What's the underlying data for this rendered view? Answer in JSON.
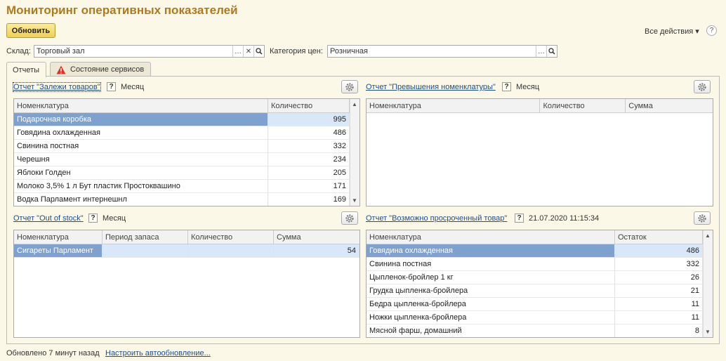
{
  "title": "Мониторинг оперативных показателей",
  "refresh_label": "Обновить",
  "all_actions": "Все действия",
  "help": "?",
  "warehouse": {
    "label": "Склад:",
    "value": "Торговый зал"
  },
  "price_category": {
    "label": "Категория цен:",
    "value": "Розничная"
  },
  "tabs": [
    {
      "label": "Отчеты"
    },
    {
      "label": "Состояние сервисов"
    }
  ],
  "reports": {
    "stale": {
      "link": "Отчет \"Залежи товаров\"",
      "period": "Месяц",
      "columns": [
        "Номенклатура",
        "Количество"
      ],
      "rows": [
        [
          "Подарочная коробка",
          "995"
        ],
        [
          "Говядина охлажденная",
          "486"
        ],
        [
          "Свинина постная",
          "332"
        ],
        [
          "Черешня",
          "234"
        ],
        [
          "Яблоки Голден",
          "205"
        ],
        [
          "Молоко 3,5% 1 л Бут пластик Простоквашино",
          "171"
        ],
        [
          "Водка Парламент интернешнл",
          "169"
        ]
      ]
    },
    "excess": {
      "link": "Отчет \"Превышения номенклатуры\"",
      "period": "Месяц",
      "columns": [
        "Номенклатура",
        "Количество",
        "Сумма"
      ],
      "rows": []
    },
    "oos": {
      "link": "Отчет \"Out of stock\"",
      "period": "Месяц",
      "columns": [
        "Номенклатура",
        "Период запаса",
        "Количество",
        "Сумма"
      ],
      "rows": [
        [
          "Сигареты Парламент",
          "",
          "",
          "54"
        ]
      ]
    },
    "expired": {
      "link": "Отчет \"Возможно просроченный товар\"",
      "period": "21.07.2020 11:15:34",
      "columns": [
        "Номенклатура",
        "Остаток"
      ],
      "rows": [
        [
          "Говядина охлажденная",
          "486"
        ],
        [
          "Свинина постная",
          "332"
        ],
        [
          "Цыпленок-бройлер 1 кг",
          "26"
        ],
        [
          "Грудка цыпленка-бройлера",
          "21"
        ],
        [
          "Бедра цыпленка-бройлера",
          "11"
        ],
        [
          "Ножки цыпленка-бройлера",
          "11"
        ],
        [
          "Мясной фарш, домашний",
          "8"
        ]
      ]
    }
  },
  "footer": {
    "status": "Обновлено 7 минут назад",
    "autoupdate_link": "Настроить автообновление..."
  }
}
